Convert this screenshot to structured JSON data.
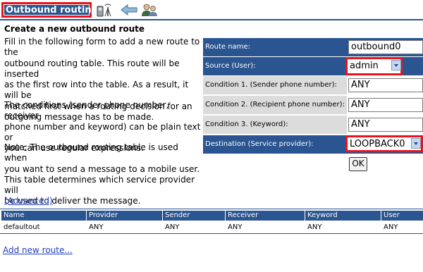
{
  "header": {
    "title": "Outbound routing"
  },
  "intro": {
    "heading": "Create a new outbound route",
    "p1": [
      "Fill in the following form to add a new route to the",
      "outbound routing table. This route will be inserted",
      "as the first row into the table. As a result, it will be",
      "matched first when a routing decision for an",
      "outgoing message has to be made."
    ],
    "p2": [
      "The conditions (sender phone number, receiver",
      "phone number and keyword) can be plain text or",
      "you can use regular expressions."
    ],
    "p3": [
      "Note: The outbound routing table is used when",
      "you want to send a message to a mobile user.",
      "This table determines which service provider will",
      "be used to deliver the message."
    ],
    "advanced": "(Advanced)"
  },
  "form": {
    "route_name": {
      "label": "Route name:",
      "value": "outbound0"
    },
    "source": {
      "label": "Source (User):",
      "value": "admin"
    },
    "cond1": {
      "label": "Condition 1. (Sender phone number):",
      "value": "ANY"
    },
    "cond2": {
      "label": "Condition 2. (Recipient phone number):",
      "value": "ANY"
    },
    "cond3": {
      "label": "Condition 3. (Keyword):",
      "value": "ANY"
    },
    "destination": {
      "label": "Destination (Service provider):",
      "value": "LOOPBACK0"
    },
    "ok": "OK"
  },
  "table": {
    "headers": [
      "Name",
      "Provider",
      "Sender",
      "Receiver",
      "Keyword",
      "User"
    ],
    "rows": [
      [
        "defaultout",
        "ANY",
        "ANY",
        "ANY",
        "ANY",
        "ANY"
      ]
    ]
  },
  "footer": {
    "add_new": "Add new route..."
  },
  "colors": {
    "brand_blue": "#2a5590",
    "highlight_red": "#e8141b",
    "link_blue": "#1d3ebb"
  },
  "icons": [
    "phone-antenna-icon",
    "back-arrow-icon",
    "users-icon"
  ]
}
